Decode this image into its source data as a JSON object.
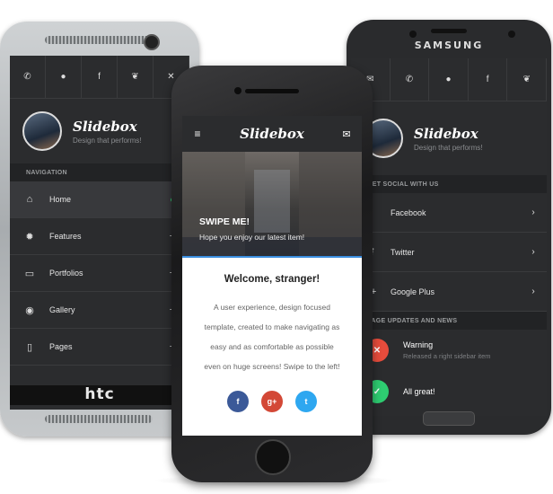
{
  "htc": {
    "brand_logo": "htc",
    "social": [
      "phone-icon",
      "chat-icon",
      "facebook-icon",
      "twitter-icon",
      "close-icon"
    ],
    "social_glyphs": [
      "✆",
      "●",
      "f",
      "❦",
      "✕"
    ],
    "app_title": "Slidebox",
    "tagline": "Design that performs!",
    "section": "NAVIGATION",
    "nav": [
      {
        "label": "Home",
        "icon": "home-icon",
        "glyph": "⌂",
        "right": "dot"
      },
      {
        "label": "Features",
        "icon": "gear-icon",
        "glyph": "✹",
        "right": "+"
      },
      {
        "label": "Portfolios",
        "icon": "image-icon",
        "glyph": "▭",
        "right": "+"
      },
      {
        "label": "Gallery",
        "icon": "camera-icon",
        "glyph": "◉",
        "right": "+"
      },
      {
        "label": "Pages",
        "icon": "file-icon",
        "glyph": "▯",
        "right": "+"
      }
    ]
  },
  "iphone": {
    "app_title": "Slidebox",
    "menu_glyph": "≡",
    "mail_glyph": "✉",
    "hero_title": "SWIPE ME!",
    "hero_subtitle": "Hope you enjoy our latest item!",
    "welcome": "Welcome, stranger!",
    "paragraph": "A user experience, design focused template, created to make navigating as easy and as comfortable as possible even on huge screens! Swipe to the left!",
    "social_buttons": [
      {
        "name": "facebook",
        "glyph": "f",
        "color": "#3b5998"
      },
      {
        "name": "google-plus",
        "glyph": "g+",
        "color": "#d34836"
      },
      {
        "name": "twitter",
        "glyph": "t",
        "color": "#2ea7f0"
      }
    ]
  },
  "samsung": {
    "brand_logo": "SAMSUNG",
    "app_title": "Slidebox",
    "tagline": "Design that performs!",
    "social": [
      "mail-icon",
      "phone-icon",
      "chat-icon",
      "facebook-icon",
      "twitter-icon"
    ],
    "social_glyphs": [
      "✉",
      "✆",
      "●",
      "f",
      "❦"
    ],
    "section_social": "GET SOCIAL WITH US",
    "social_items": [
      {
        "label": "Facebook",
        "icon": "facebook-icon",
        "glyph": "f"
      },
      {
        "label": "Twitter",
        "icon": "twitter-icon",
        "glyph": "❦"
      },
      {
        "label": "Google Plus",
        "icon": "google-plus-icon",
        "glyph": "g+"
      }
    ],
    "section_updates": "PAGE UPDATES AND NEWS",
    "updates": [
      {
        "title": "Warning",
        "subtitle": "Released a right sidebar item",
        "glyph": "✕",
        "color": "#e74c3c"
      },
      {
        "title": "All great!",
        "subtitle": "",
        "glyph": "✓",
        "color": "#2ecc71"
      }
    ]
  }
}
